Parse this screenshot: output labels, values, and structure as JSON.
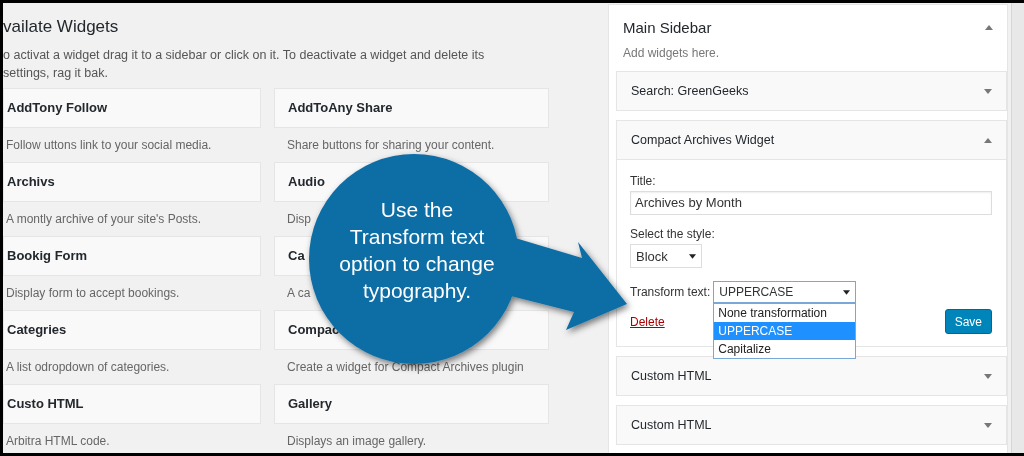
{
  "available_widgets": {
    "title": "vailate Widgets",
    "description": "o activat a widget drag it to a sidebar or click on it. To deactivate a widget and delete its settings, rag it bak.",
    "widgets": [
      {
        "name": "AddTony Follow",
        "description": "Follow uttons link to your social media."
      },
      {
        "name": "AddToAny Share",
        "description": "Share buttons for sharing your content."
      },
      {
        "name": "Archivs",
        "description": "A montly archive of your site's Posts."
      },
      {
        "name": "Audio",
        "description": "Disp"
      },
      {
        "name": "Bookig Form",
        "description": "Display form to accept bookings."
      },
      {
        "name": "Ca",
        "description": "A ca"
      },
      {
        "name": "Categries",
        "description": "A list odropdown of categories."
      },
      {
        "name": "Compac",
        "description": "Create a widget for Compact Archives plugin"
      },
      {
        "name": "Custo HTML",
        "description": "Arbitra HTML code."
      },
      {
        "name": "Gallery",
        "description": "Displays an image gallery."
      }
    ]
  },
  "sidebar": {
    "title": "Main Sidebar",
    "description": "Add widgets here.",
    "expanded": true,
    "widgets": [
      {
        "title": "Search: GreenGeeks",
        "expanded": false
      },
      {
        "title": "Compact Archives Widget",
        "expanded": true,
        "form": {
          "title_label": "Title:",
          "title_value": "Archives by Month",
          "style_label": "Select the style:",
          "style_value": "Block",
          "transform_label": "Transform text:",
          "transform_value": "UPPERCASE",
          "transform_options": [
            {
              "label": "None transformation",
              "selected": false
            },
            {
              "label": "UPPERCASE",
              "selected": true
            },
            {
              "label": "Capitalize",
              "selected": false
            }
          ],
          "delete": "Delete",
          "save": "Save"
        }
      },
      {
        "title": "Custom HTML",
        "expanded": false
      },
      {
        "title": "Custom HTML",
        "expanded": false
      }
    ]
  },
  "callout": {
    "text": "Use the Transform text option to change typography."
  }
}
